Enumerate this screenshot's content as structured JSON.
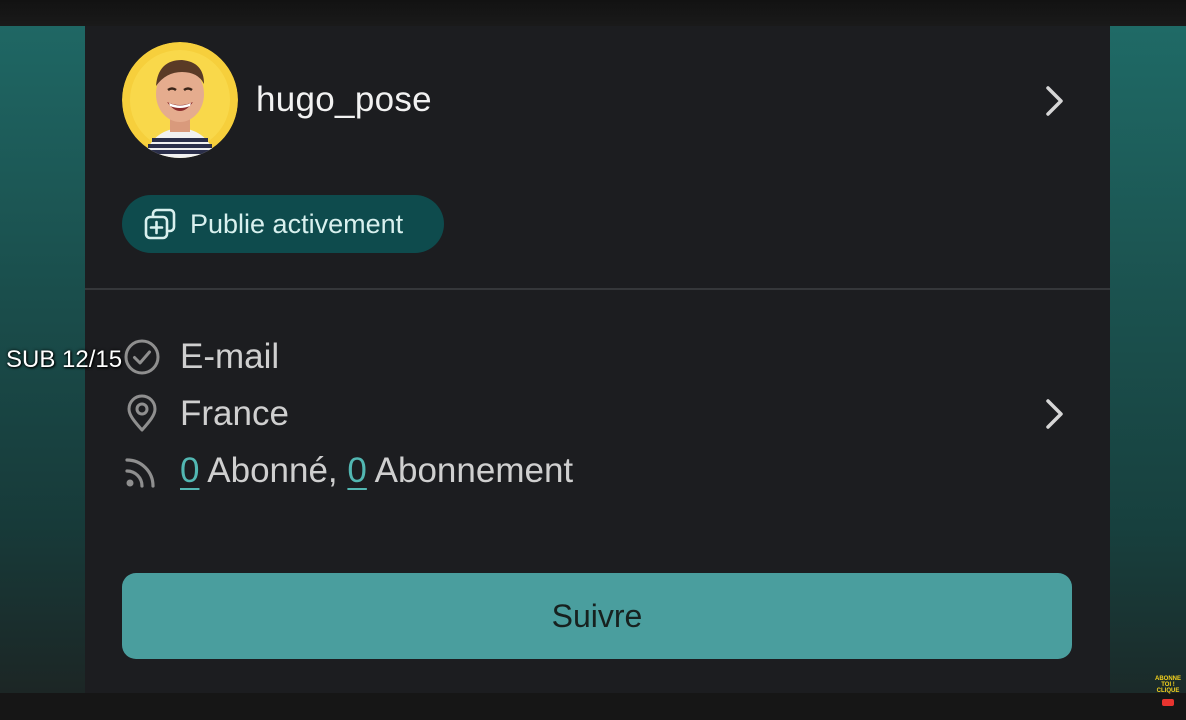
{
  "profile": {
    "username": "hugo_pose",
    "avatar_icon": "user-avatar",
    "status_badge": "Publie activement",
    "badge_icon": "add-gallery-icon"
  },
  "details": {
    "email": "E-mail",
    "location": "France",
    "followers_count": "0",
    "followers_label": " Abonné, ",
    "following_count": "0",
    "following_label": " Abonnement"
  },
  "actions": {
    "follow_label": "Suivre"
  },
  "overlay": {
    "sub_counter": "SUB 12/15",
    "watermark": "ABONNE\nTOI !\nCLIQUE"
  },
  "colors": {
    "accent": "#4a9e9e",
    "link": "#52b7b2",
    "badge_bg": "#0e4b4d",
    "panel_bg": "#1c1d20"
  }
}
